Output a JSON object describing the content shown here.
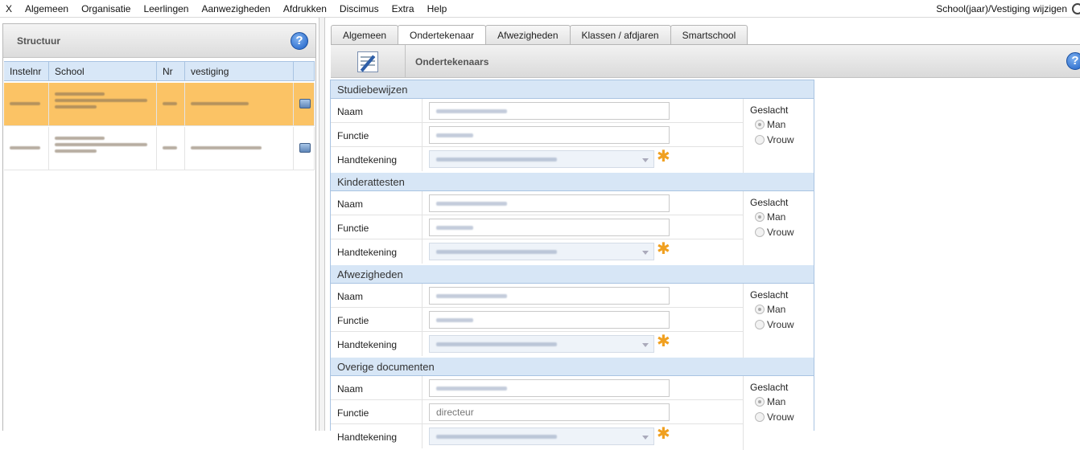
{
  "menu": {
    "items": [
      "X",
      "Algemeen",
      "Organisatie",
      "Leerlingen",
      "Aanwezigheden",
      "Afdrukken",
      "Discimus",
      "Extra",
      "Help"
    ],
    "right_label": "School(jaar)/Vestiging wijzigen"
  },
  "left": {
    "title": "Structuur",
    "help": "?",
    "columns": [
      "Instelnr",
      "School",
      "Nr",
      "vestiging"
    ]
  },
  "tabs": [
    "Algemeen",
    "Ondertekenaar",
    "Afwezigheden",
    "Klassen / afdjaren",
    "Smartschool"
  ],
  "toolbar": {
    "title": "Ondertekenaars",
    "help": "?"
  },
  "form": {
    "field_labels": {
      "naam": "Naam",
      "functie": "Functie",
      "handtekening": "Handtekening"
    },
    "gender": {
      "label": "Geslacht",
      "man": "Man",
      "vrouw": "Vrouw"
    },
    "sections": [
      {
        "title": "Studiebewijzen",
        "functie_value": ""
      },
      {
        "title": "Kinderattesten",
        "functie_value": ""
      },
      {
        "title": "Afwezigheden",
        "functie_value": ""
      },
      {
        "title": "Overige documenten",
        "functie_value": "directeur"
      }
    ]
  }
}
